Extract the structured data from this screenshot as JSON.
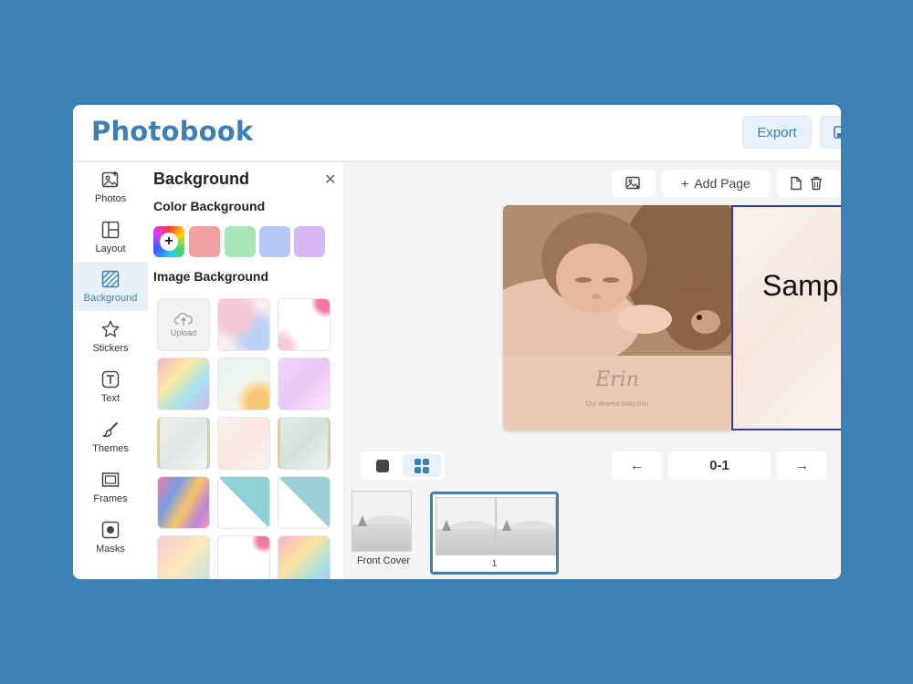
{
  "app": {
    "title": "Photobook"
  },
  "header": {
    "export_label": "Export"
  },
  "sidebar": {
    "items": [
      {
        "label": "Photos",
        "icon": "image-add-icon"
      },
      {
        "label": "Layout",
        "icon": "layout-icon"
      },
      {
        "label": "Background",
        "icon": "background-icon",
        "active": true
      },
      {
        "label": "Stickers",
        "icon": "star-icon"
      },
      {
        "label": "Text",
        "icon": "text-icon"
      },
      {
        "label": "Themes",
        "icon": "brush-icon"
      },
      {
        "label": "Frames",
        "icon": "frame-icon"
      },
      {
        "label": "Masks",
        "icon": "mask-icon"
      }
    ]
  },
  "panel": {
    "title": "Background",
    "color_section": "Color Background",
    "image_section": "Image Background",
    "upload_label": "Upload",
    "swatches": [
      "#f0a0a0",
      "#a8e6b8",
      "#b6c8f8",
      "#d6b8f8"
    ]
  },
  "toolbar": {
    "add_page_label": "Add Page"
  },
  "page": {
    "name": "Erin",
    "subtitle": "Our dearest baby Erin",
    "sample_text": "Sample"
  },
  "pager": {
    "value": "0-1",
    "prev": "←",
    "next": "→"
  },
  "thumbnails": {
    "front_cover_label": "Front Cover",
    "spread_number": "1"
  },
  "colors": {
    "accent": "#3f7fb3",
    "background": "#3d82b6",
    "selection": "#2a3bb5"
  }
}
